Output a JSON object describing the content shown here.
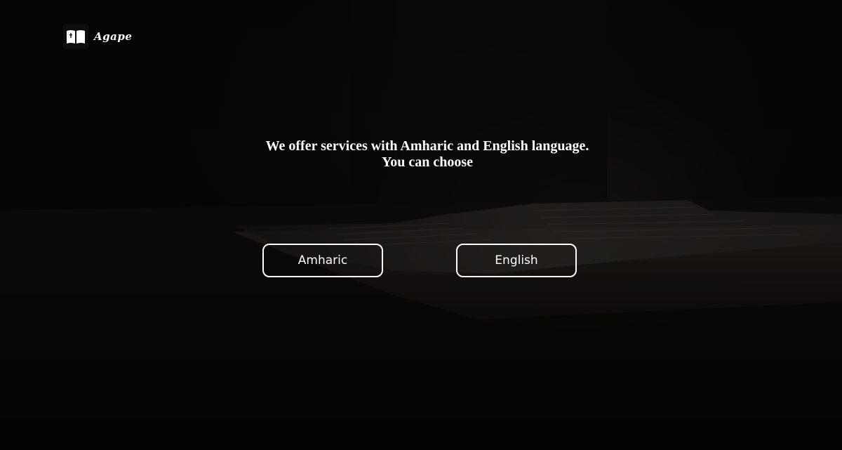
{
  "brand": {
    "name": "Agape",
    "icon": "open-book-icon"
  },
  "headline": {
    "line1": "We offer services with Amharic and English language.",
    "line2": "You can choose"
  },
  "languages": {
    "amharic_label": "Amharic",
    "english_label": "English"
  },
  "colors": {
    "background": "#050505",
    "text": "#ffffff",
    "button_border": "#ffffff"
  }
}
